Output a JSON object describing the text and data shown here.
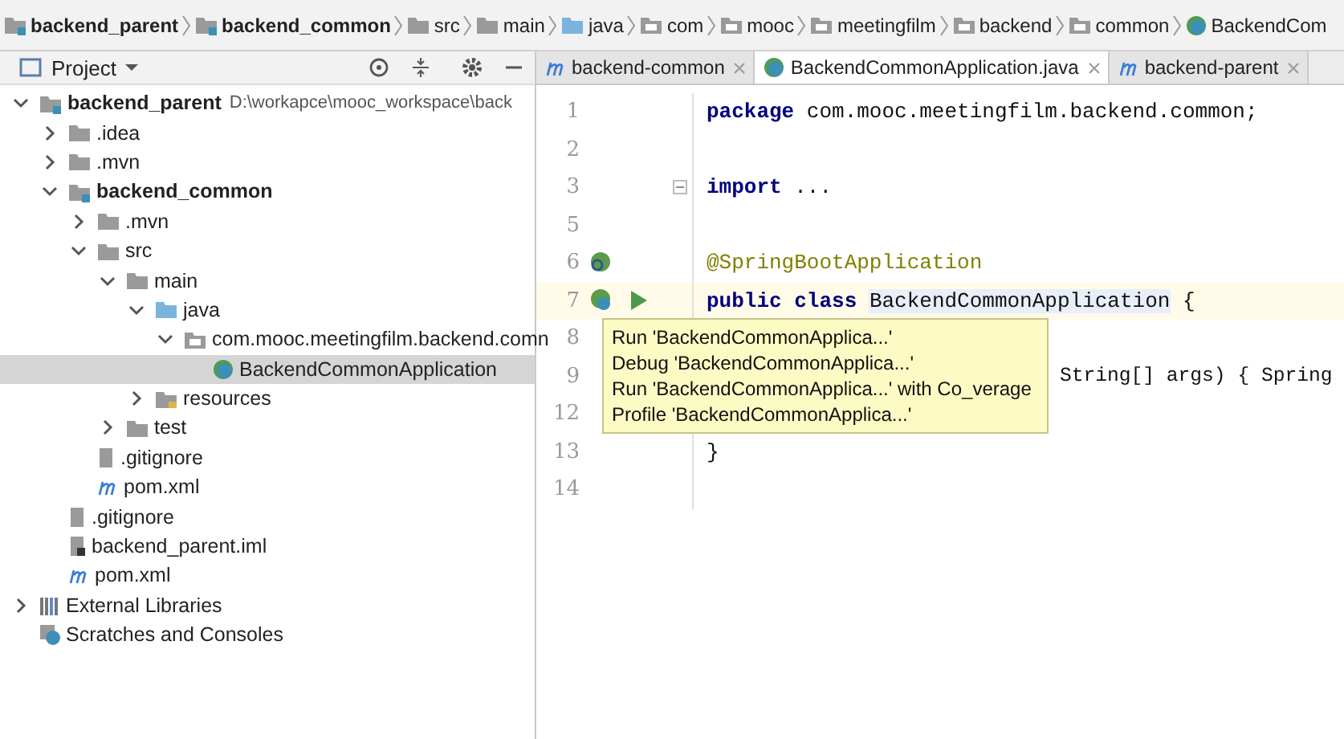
{
  "breadcrumbs": [
    {
      "label": "backend_parent",
      "kind": "module"
    },
    {
      "label": "backend_common",
      "kind": "module"
    },
    {
      "label": "src",
      "kind": "folder"
    },
    {
      "label": "main",
      "kind": "folder"
    },
    {
      "label": "java",
      "kind": "source"
    },
    {
      "label": "com",
      "kind": "package"
    },
    {
      "label": "mooc",
      "kind": "package"
    },
    {
      "label": "meetingfilm",
      "kind": "package"
    },
    {
      "label": "backend",
      "kind": "package"
    },
    {
      "label": "common",
      "kind": "package"
    },
    {
      "label": "BackendCom",
      "kind": "class"
    }
  ],
  "project_panel": {
    "title": "Project",
    "tree": [
      {
        "label": "backend_parent",
        "path": "D:\\workapce\\mooc_workspace\\back",
        "kind": "module",
        "bold": true,
        "expanded": true,
        "selected": false,
        "children": [
          {
            "label": ".idea",
            "kind": "folder",
            "expanded": false,
            "selected": false
          },
          {
            "label": ".mvn",
            "kind": "folder",
            "expanded": false,
            "selected": false
          },
          {
            "label": "backend_common",
            "kind": "module",
            "bold": true,
            "expanded": true,
            "selected": false,
            "children": [
              {
                "label": ".mvn",
                "kind": "folder",
                "expanded": false,
                "selected": false
              },
              {
                "label": "src",
                "kind": "folder",
                "expanded": true,
                "selected": false,
                "children": [
                  {
                    "label": "main",
                    "kind": "folder",
                    "expanded": true,
                    "selected": false,
                    "children": [
                      {
                        "label": "java",
                        "kind": "source",
                        "expanded": true,
                        "selected": false,
                        "children": [
                          {
                            "label": "com.mooc.meetingfilm.backend.comn",
                            "kind": "package",
                            "expanded": true,
                            "selected": false,
                            "children": [
                              {
                                "label": "BackendCommonApplication",
                                "kind": "class",
                                "selected": true
                              }
                            ]
                          }
                        ]
                      },
                      {
                        "label": "resources",
                        "kind": "resources",
                        "expanded": false,
                        "selected": false
                      }
                    ]
                  },
                  {
                    "label": "test",
                    "kind": "folder",
                    "expanded": false,
                    "selected": false
                  }
                ]
              },
              {
                "label": ".gitignore",
                "kind": "file",
                "selected": false
              },
              {
                "label": "pom.xml",
                "kind": "maven",
                "selected": false
              }
            ]
          },
          {
            "label": ".gitignore",
            "kind": "file",
            "selected": false
          },
          {
            "label": "backend_parent.iml",
            "kind": "iml",
            "selected": false
          },
          {
            "label": "pom.xml",
            "kind": "maven",
            "selected": false
          }
        ]
      },
      {
        "label": "External Libraries",
        "kind": "libraries",
        "expanded": false,
        "selected": false
      },
      {
        "label": "Scratches and Consoles",
        "kind": "scratches",
        "selected": false
      }
    ]
  },
  "editor_tabs": [
    {
      "label": "backend-common",
      "kind": "maven",
      "selected": false
    },
    {
      "label": "BackendCommonApplication.java",
      "kind": "class",
      "selected": true
    },
    {
      "label": "backend-parent",
      "kind": "maven",
      "selected": false
    }
  ],
  "editor": {
    "lines": [
      {
        "number": "1",
        "current": false,
        "tokens": [
          {
            "text": "package",
            "kind": "keyword"
          },
          {
            "text": "com.mooc.meetingfilm.backend.common;",
            "kind": "plain"
          }
        ]
      },
      {
        "number": "2",
        "current": false
      },
      {
        "number": "3",
        "current": false,
        "fold": true,
        "tokens": [
          {
            "text": "import",
            "kind": "keyword"
          },
          {
            "text": "...",
            "kind": "plain"
          }
        ]
      },
      {
        "number": "5",
        "current": false
      },
      {
        "number": "6",
        "current": false,
        "gutter": [
          {
            "kind": "bean"
          }
        ],
        "tokens": [
          {
            "text": "@SpringBootApplication",
            "kind": "annotation"
          }
        ]
      },
      {
        "number": "7",
        "current": true,
        "gutter": [
          {
            "kind": "bean-class"
          },
          {
            "kind": "run"
          }
        ],
        "tokens": [
          {
            "text": "public class",
            "kind": "keyword"
          },
          {
            "text": "BackendCommonApplication",
            "kind": "highlight"
          },
          {
            "text": "{",
            "kind": "plain"
          }
        ]
      },
      {
        "number": "8",
        "current": false
      },
      {
        "number": "9",
        "current": false,
        "covered": true,
        "tokens": [
          {
            "text": "String[] args) { Spring",
            "kind": "plain"
          }
        ]
      },
      {
        "number": "12",
        "current": false
      },
      {
        "number": "13",
        "current": false,
        "tokens": [
          {
            "text": "}",
            "kind": "plain"
          }
        ]
      },
      {
        "number": "14",
        "current": false
      }
    ]
  },
  "run_popup": {
    "items": [
      "Run 'BackendCommonApplica...'",
      "Debug 'BackendCommonApplica...'",
      "Run 'BackendCommonApplica...' with Co_verage",
      "Profile 'BackendCommonApplica...'"
    ]
  }
}
